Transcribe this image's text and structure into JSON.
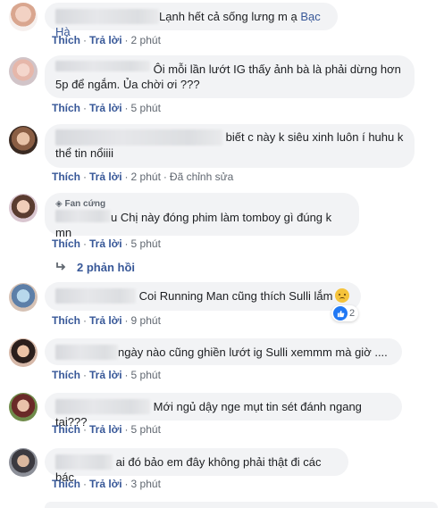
{
  "actions": {
    "like": "Thích",
    "reply": "Trả lời",
    "edited": "Đã chỉnh sửa"
  },
  "comments": [
    {
      "text": "Lạnh hết cả sống lưng m ạ",
      "mention": "Bạc Hà",
      "time": "2 phút"
    },
    {
      "text_line1": "Ôi mỗi lần lướt IG thấy ảnh bà là phải dừng hơn",
      "text_line2": "5p để ngắm. Ủa chời ơi ???",
      "time": "5 phút"
    },
    {
      "text_line1": "biết c này k siêu xinh luôn í huhu k",
      "text_line2": "thể tin nổiiii",
      "time": "2 phút"
    },
    {
      "badge": "Fan cứng",
      "text": "u Chị này đóng phim làm tomboy gì đúng k mn",
      "time": "5 phút",
      "replies": "2 phản hồi"
    },
    {
      "text": "Coi Running Man cũng thích Sulli lắm",
      "time": "9 phút",
      "reaction_count": "2"
    },
    {
      "text": "ngày nào cũng ghiền lướt ig Sulli xemmm mà giờ ....",
      "time": "5 phút"
    },
    {
      "text": "Mới ngủ dậy nge mụt tin sét đánh ngang tai???",
      "time": "5 phút"
    },
    {
      "text": "ai đó bảo em đây không phải thật đi các bác",
      "time": "3 phút"
    }
  ],
  "colors": {
    "bubble": "#f2f3f5",
    "link": "#385898",
    "meta": "#606770",
    "like": "#2078f4"
  }
}
